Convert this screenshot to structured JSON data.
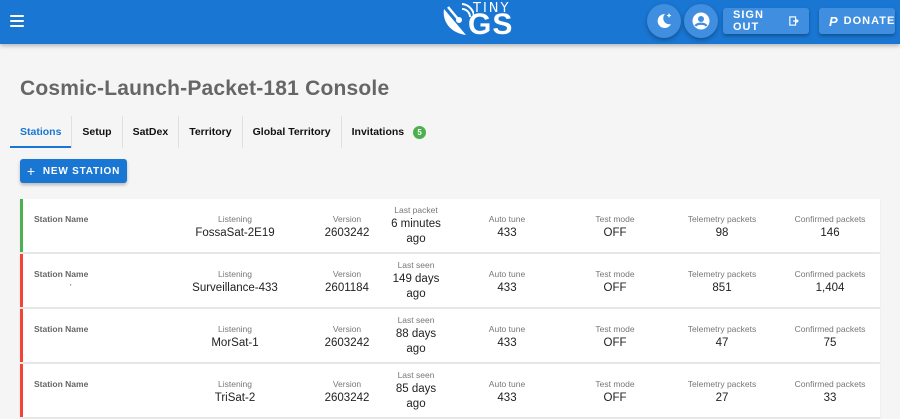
{
  "app": {
    "logo_tiny": "TINY",
    "logo_main": "GS",
    "signout_label": "SIGN OUT",
    "donate_label": "DONATE",
    "donate_prefix": "P",
    "accent": "#1976d2"
  },
  "page": {
    "title": "Cosmic-Launch-Packet-181 Console"
  },
  "tabs": [
    {
      "label": "Stations"
    },
    {
      "label": "Setup"
    },
    {
      "label": "SatDex"
    },
    {
      "label": "Territory"
    },
    {
      "label": "Global Territory"
    },
    {
      "label": "Invitations",
      "badge": "5"
    }
  ],
  "new_station": {
    "plus": "+",
    "label": "NEW STATION"
  },
  "labels": {
    "name": "Station Name",
    "listening": "Listening",
    "version": "Version",
    "last_packet": "Last packet",
    "last_seen": "Last seen",
    "auto_tune": "Auto tune",
    "test_mode": "Test mode",
    "telemetry": "Telemetry packets",
    "confirmed": "Confirmed packets"
  },
  "stations": [
    {
      "status_color": "#4caf50",
      "name": "",
      "listening": "FossaSat-2E19",
      "version": "2603242",
      "last_time": "6 minutes",
      "last_ago": "ago",
      "auto_tune": "433",
      "test_mode": "OFF",
      "telemetry": "98",
      "confirmed": "146"
    },
    {
      "status_color": "#f44336",
      "name": "'",
      "listening": "Surveillance-433",
      "version": "2601184",
      "last_time": "149 days",
      "last_ago": "ago",
      "auto_tune": "433",
      "test_mode": "OFF",
      "telemetry": "851",
      "confirmed": "1,404"
    },
    {
      "status_color": "#f44336",
      "name": "",
      "listening": "MorSat-1",
      "version": "2603242",
      "last_time": "88 days",
      "last_ago": "ago",
      "auto_tune": "433",
      "test_mode": "OFF",
      "telemetry": "47",
      "confirmed": "75"
    },
    {
      "status_color": "#f44336",
      "name": "",
      "listening": "TriSat-2",
      "version": "2603242",
      "last_time": "85 days",
      "last_ago": "ago",
      "auto_tune": "433",
      "test_mode": "OFF",
      "telemetry": "27",
      "confirmed": "33"
    }
  ]
}
